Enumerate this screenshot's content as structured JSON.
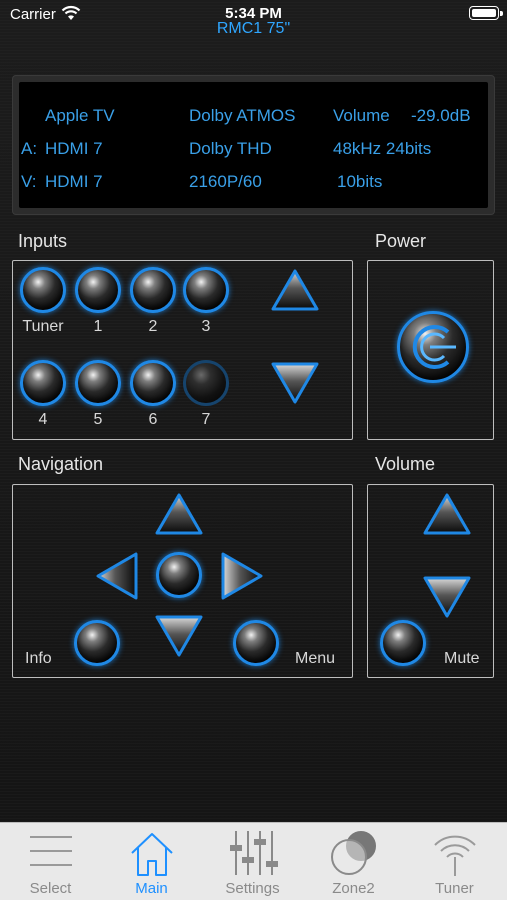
{
  "status": {
    "carrier": "Carrier",
    "time": "5:34 PM",
    "device": "RMC1 75\""
  },
  "display": {
    "row1": {
      "source": "Apple TV",
      "format": "Dolby ATMOS",
      "volume_label": "Volume",
      "volume_value": "-29.0dB"
    },
    "row2": {
      "prefix": "A:",
      "input": "HDMI 7",
      "format": "Dolby THD",
      "rate": "48kHz 24bits"
    },
    "row3": {
      "prefix": "V:",
      "input": "HDMI 7",
      "resolution": "2160P/60",
      "depth": "10bits"
    }
  },
  "inputs": {
    "title": "Inputs",
    "buttons": [
      {
        "label": "Tuner"
      },
      {
        "label": "1"
      },
      {
        "label": "2"
      },
      {
        "label": "3"
      },
      {
        "label": "4"
      },
      {
        "label": "5"
      },
      {
        "label": "6"
      },
      {
        "label": "7"
      }
    ]
  },
  "power": {
    "title": "Power"
  },
  "navigation": {
    "title": "Navigation",
    "info_label": "Info",
    "menu_label": "Menu"
  },
  "volume": {
    "title": "Volume",
    "mute_label": "Mute"
  },
  "tabs": [
    {
      "label": "Select",
      "icon": "list-icon"
    },
    {
      "label": "Main",
      "icon": "home-icon"
    },
    {
      "label": "Settings",
      "icon": "sliders-icon"
    },
    {
      "label": "Zone2",
      "icon": "zone-icon"
    },
    {
      "label": "Tuner",
      "icon": "antenna-icon"
    }
  ],
  "colors": {
    "accent": "#1f88e5",
    "display_text": "#3aa0e8",
    "active_tab": "#1e90ff"
  }
}
